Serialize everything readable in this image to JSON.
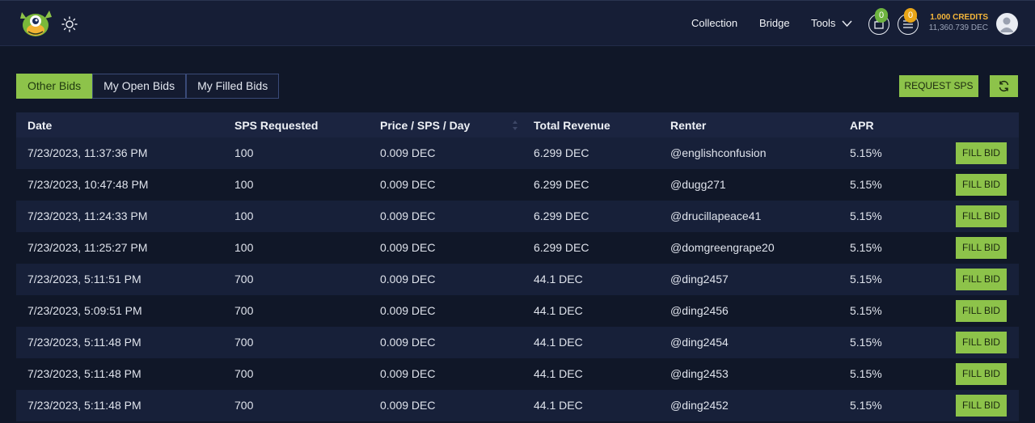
{
  "nav": {
    "collection": "Collection",
    "bridge": "Bridge",
    "tools": "Tools",
    "cart_count": "0",
    "list_count": "0",
    "credits": "1.000 CREDITS",
    "dec": "11,360.739 DEC",
    "colors": {
      "cart_badge": "#6db33f",
      "list_badge": "#e8a517",
      "credits": "#f5b63a"
    }
  },
  "tabs": [
    "Other Bids",
    "My Open Bids",
    "My Filled Bids"
  ],
  "active_tab": "Other Bids",
  "actions": {
    "request": "REQUEST SPS"
  },
  "table": {
    "headers": [
      "Date",
      "SPS Requested",
      "Price / SPS / Day",
      "Total Revenue",
      "Renter",
      "APR"
    ],
    "fill_label": "FILL BID",
    "rows": [
      {
        "date": "7/23/2023, 11:37:36 PM",
        "sps": "100",
        "price": "0.009 DEC",
        "revenue": "6.299 DEC",
        "renter": "@englishconfusion",
        "apr": "5.15%"
      },
      {
        "date": "7/23/2023, 10:47:48 PM",
        "sps": "100",
        "price": "0.009 DEC",
        "revenue": "6.299 DEC",
        "renter": "@dugg271",
        "apr": "5.15%"
      },
      {
        "date": "7/23/2023, 11:24:33 PM",
        "sps": "100",
        "price": "0.009 DEC",
        "revenue": "6.299 DEC",
        "renter": "@drucillapeace41",
        "apr": "5.15%"
      },
      {
        "date": "7/23/2023, 11:25:27 PM",
        "sps": "100",
        "price": "0.009 DEC",
        "revenue": "6.299 DEC",
        "renter": "@domgreengrape20",
        "apr": "5.15%"
      },
      {
        "date": "7/23/2023, 5:11:51 PM",
        "sps": "700",
        "price": "0.009 DEC",
        "revenue": "44.1 DEC",
        "renter": "@ding2457",
        "apr": "5.15%"
      },
      {
        "date": "7/23/2023, 5:09:51 PM",
        "sps": "700",
        "price": "0.009 DEC",
        "revenue": "44.1 DEC",
        "renter": "@ding2456",
        "apr": "5.15%"
      },
      {
        "date": "7/23/2023, 5:11:48 PM",
        "sps": "700",
        "price": "0.009 DEC",
        "revenue": "44.1 DEC",
        "renter": "@ding2454",
        "apr": "5.15%"
      },
      {
        "date": "7/23/2023, 5:11:48 PM",
        "sps": "700",
        "price": "0.009 DEC",
        "revenue": "44.1 DEC",
        "renter": "@ding2453",
        "apr": "5.15%"
      },
      {
        "date": "7/23/2023, 5:11:48 PM",
        "sps": "700",
        "price": "0.009 DEC",
        "revenue": "44.1 DEC",
        "renter": "@ding2452",
        "apr": "5.15%"
      }
    ]
  },
  "theme": {
    "accent": "#8dc34a",
    "background": "#101728",
    "header_bg": "#161e36"
  }
}
